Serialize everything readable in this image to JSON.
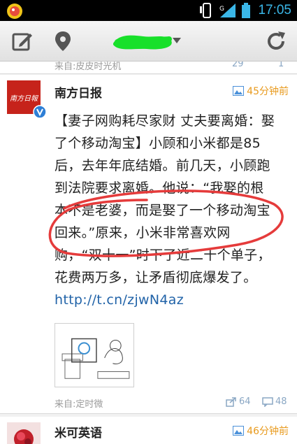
{
  "status_bar": {
    "time": "17:05"
  },
  "previous_post": {
    "source": "来自:皮皮时光机",
    "reposts": "29",
    "comments": "1"
  },
  "posts": [
    {
      "user": "南方日报",
      "avatar_text": "南方日報",
      "time": "45分钟前",
      "text_segments": [
        "【妻子网购耗尽家财 丈夫要离婚：娶了个移动淘宝】小顾和小米都是85后，去年年底结婚。前几天，小顾跑到法院要求离婚。他说：“我娶的根本不是老婆，而是娶了一个移动淘宝回来。”原来，小米非常喜欢网购，“双十一”时下了近二十个单子，花费两万多，让矛盾彻底爆发了。",
        "http://t.cn/zjwN4az"
      ],
      "source": "来自:定时微",
      "reposts": "64",
      "comments": "48"
    },
    {
      "user": "米可英语",
      "time": "46分钟前"
    }
  ],
  "colors": {
    "time": "#e89a1d",
    "link": "#2163a8",
    "counts": "#8aa7c4",
    "annotation": "#e53b3b",
    "title_scribble": "#18e02a"
  }
}
